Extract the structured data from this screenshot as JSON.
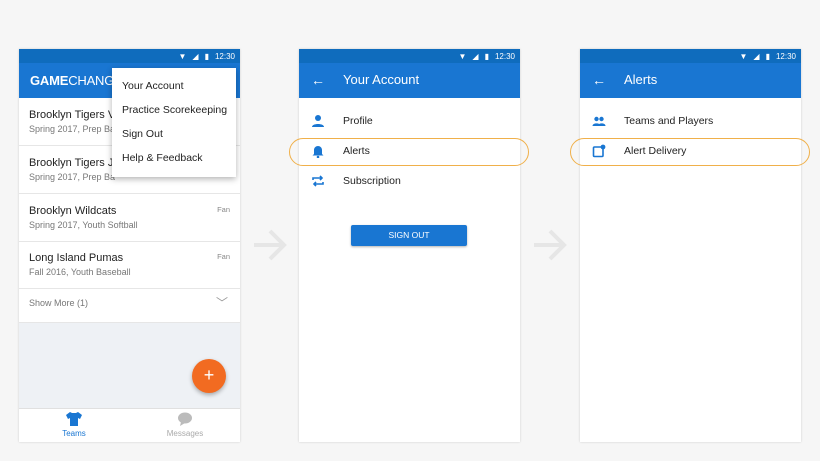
{
  "status": {
    "time": "12:30"
  },
  "screen1": {
    "logo_bold": "GAME",
    "logo_light": "CHANG",
    "menu": [
      "Your Account",
      "Practice Scorekeeping",
      "Sign Out",
      "Help & Feedback"
    ],
    "teams": [
      {
        "name": "Brooklyn Tigers Va",
        "sub": "Spring 2017, Prep Ba",
        "badge": ""
      },
      {
        "name": "Brooklyn Tigers JV",
        "sub": "Spring 2017, Prep Ba",
        "badge": ""
      },
      {
        "name": "Brooklyn Wildcats",
        "sub": "Spring 2017, Youth Softball",
        "badge": "Fan"
      },
      {
        "name": "Long Island Pumas",
        "sub": "Fall 2016, Youth Baseball",
        "badge": "Fan"
      }
    ],
    "show_more": "Show More (1)",
    "fab": "+",
    "nav": [
      {
        "label": "Teams",
        "icon": "jersey-icon",
        "active": true
      },
      {
        "label": "Messages",
        "icon": "chat-bubble-icon",
        "active": false
      }
    ]
  },
  "screen2": {
    "title": "Your Account",
    "items": [
      {
        "label": "Profile",
        "icon": "person-icon"
      },
      {
        "label": "Alerts",
        "icon": "bell-icon",
        "highlighted": true
      },
      {
        "label": "Subscription",
        "icon": "repeat-icon"
      }
    ],
    "sign_out": "SIGN OUT"
  },
  "screen3": {
    "title": "Alerts",
    "items": [
      {
        "label": "Teams and Players",
        "icon": "people-icon"
      },
      {
        "label": "Alert Delivery",
        "icon": "notification-icon",
        "highlighted": true
      }
    ]
  },
  "colors": {
    "primary": "#1976d2",
    "statusbar": "#0f6cbd",
    "accent": "#f26b21",
    "highlight": "#f0b04a"
  }
}
